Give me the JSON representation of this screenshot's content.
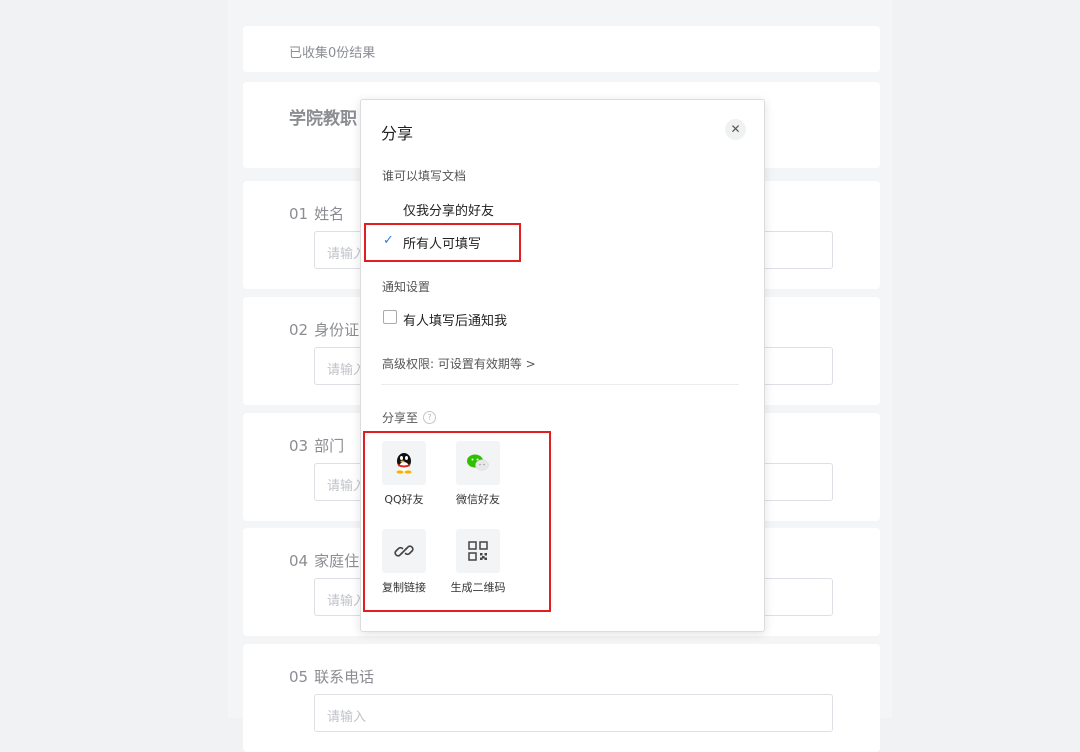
{
  "background": {
    "collected": "已收集0份结果",
    "form_title": "学院教职",
    "questions": [
      {
        "num": "01",
        "label": "姓名",
        "placeholder": "请输入"
      },
      {
        "num": "02",
        "label": "身份证",
        "placeholder": "请输入"
      },
      {
        "num": "03",
        "label": "部门",
        "placeholder": "请输入"
      },
      {
        "num": "04",
        "label": "家庭住",
        "placeholder": "请输入"
      },
      {
        "num": "05",
        "label": "联系电话",
        "placeholder": "请输入"
      }
    ]
  },
  "dialog": {
    "title": "分享",
    "close_icon": "close-icon",
    "who_can_fill_label": "谁可以填写文档",
    "options": [
      "仅我分享的好友",
      "所有人可填写"
    ],
    "selected_option": "所有人可填写",
    "notify_label": "通知设置",
    "notify_option": "有人填写后通知我",
    "notify_checked": false,
    "advanced": "高级权限: 可设置有效期等 >",
    "share_to_label": "分享至",
    "share_targets": [
      {
        "label": "QQ好友",
        "icon": "qq-icon"
      },
      {
        "label": "微信好友",
        "icon": "wechat-icon"
      },
      {
        "label": "复制链接",
        "icon": "link-icon"
      },
      {
        "label": "生成二维码",
        "icon": "qrcode-icon"
      }
    ]
  },
  "colors": {
    "accent": "#2f7bf0",
    "highlight": "#e02020"
  }
}
